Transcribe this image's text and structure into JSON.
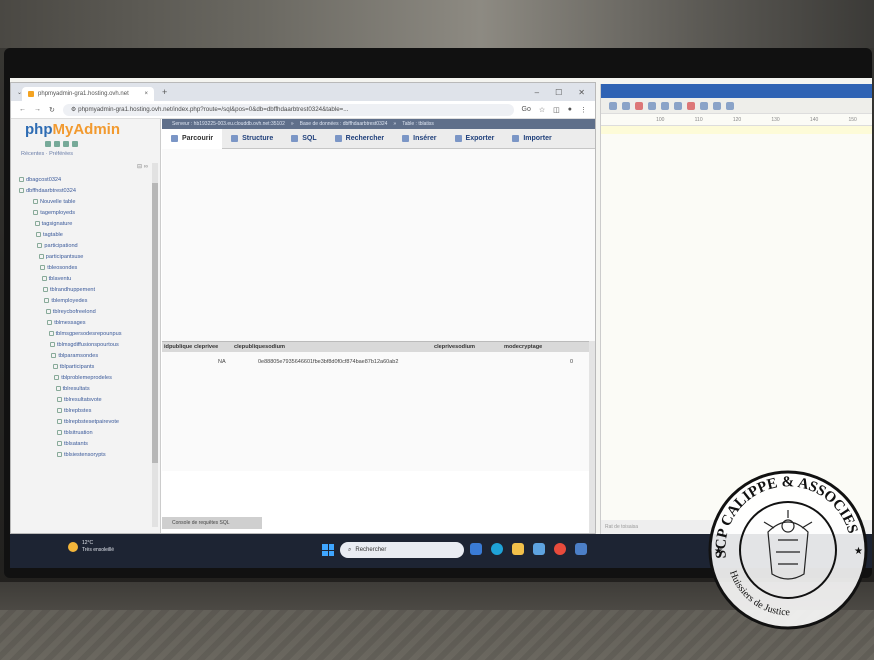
{
  "browser": {
    "tab_title": "phpmyadmin-gra1.hosting.ovh.net",
    "tab_close": "×",
    "new_tab": "+",
    "window_controls": [
      "–",
      "☐",
      "✕"
    ],
    "url": "phpmyadmin-gra1.hosting.ovh.net/index.php?route=/sql&pos=0&db=dbffhdaarbtrest0324&table=...",
    "zoom_badge": "Go"
  },
  "pma": {
    "logo_php": "php",
    "logo_myadmin": "MyAdmin",
    "recent_label": "Récentes · Préférées",
    "tree": [
      "dbagcost0324",
      "dbffhdaarbtrest0324",
      "Nouvelle table",
      "tagemployeds",
      "tagsignature",
      "tagtable",
      "participationd",
      "participantsuse",
      "tbleosondes",
      "tblaventu",
      "tblrandhuppement",
      "tblemployedes",
      "tblreycbofreelond",
      "tblmessages",
      "tblmsgpersodesrepounpus",
      "tblmsgdiffusionspourtous",
      "tblparamsondes",
      "tblparticipants",
      "tblproblemeprodeles",
      "tblresultats",
      "tblresultatsvote",
      "tblrepbstes",
      "tblrepbstesetpairevote",
      "tblsitruation",
      "tblsatants",
      "tblsiestensorypts"
    ],
    "server_bar": [
      "Serveur : hb193225-003.eu.clouddb.ovh.net:35102",
      "Base de données : dbffhdaarbtrest0324",
      "Table : tblatiss"
    ],
    "menu_tabs": [
      "Parcourir",
      "Structure",
      "SQL",
      "Rechercher",
      "Insérer",
      "Exporter",
      "Importer"
    ],
    "columns": [
      "idpublique",
      "cleprivee",
      "clepubliquesodium",
      "cleprivesodium",
      "modecryptage"
    ],
    "row": {
      "cleprivee": "NA",
      "clepubliquesodium": "0e88805e7935646601fbe3bf8d0f0cf874bae87b12a60ab2",
      "modecryptage": "0"
    },
    "console_label": "Console de requêtes SQL"
  },
  "bgapp": {
    "ruler": [
      "100",
      "110",
      "120",
      "130",
      "140",
      "150"
    ],
    "footer": "Rat de toisaisa"
  },
  "taskbar": {
    "weather_temp": "12°C",
    "weather_desc": "Très ensoleillé",
    "search_placeholder": "Rechercher"
  },
  "stamp": {
    "text_top": "SCP CALIPPE & ASSOCIES",
    "text_bottom": "Huissiers de Justice"
  }
}
